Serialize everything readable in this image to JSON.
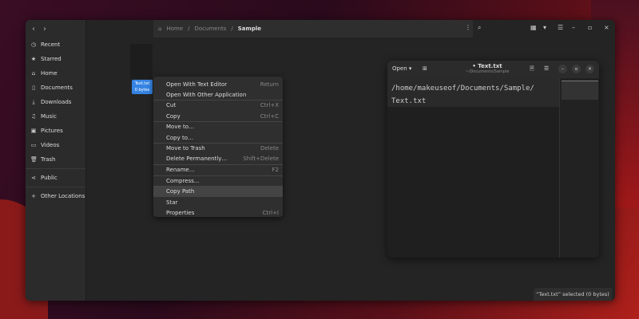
{
  "files": {
    "breadcrumb": [
      "Home",
      "Documents",
      "Sample"
    ],
    "sidebar": [
      {
        "icon": "clock",
        "label": "Recent"
      },
      {
        "icon": "star",
        "label": "Starred"
      },
      {
        "icon": "home",
        "label": "Home"
      },
      {
        "icon": "document",
        "label": "Documents"
      },
      {
        "icon": "download",
        "label": "Downloads"
      },
      {
        "icon": "music",
        "label": "Music"
      },
      {
        "icon": "picture",
        "label": "Pictures"
      },
      {
        "icon": "video",
        "label": "Videos"
      },
      {
        "icon": "trash",
        "label": "Trash"
      },
      {
        "icon": "share",
        "label": "Public"
      },
      {
        "icon": "plus",
        "label": "Other Locations"
      }
    ],
    "file": {
      "name": "Text.txt",
      "size": "0 bytes"
    },
    "status": "“Text.txt” selected (0 bytes)"
  },
  "menu": [
    {
      "label": "Open With Text Editor",
      "accel": "Return"
    },
    {
      "label": "Open With Other Application",
      "accel": ""
    },
    {
      "label": "Cut",
      "accel": "Ctrl+X"
    },
    {
      "label": "Copy",
      "accel": "Ctrl+C"
    },
    {
      "label": "Move to…",
      "accel": ""
    },
    {
      "label": "Copy to…",
      "accel": ""
    },
    {
      "label": "Move to Trash",
      "accel": "Delete"
    },
    {
      "label": "Delete Permanently…",
      "accel": "Shift+Delete"
    },
    {
      "label": "Rename…",
      "accel": "F2"
    },
    {
      "label": "Compress…",
      "accel": ""
    },
    {
      "label": "Copy Path",
      "accel": ""
    },
    {
      "label": "Star",
      "accel": ""
    },
    {
      "label": "Properties",
      "accel": "Ctrl+I"
    }
  ],
  "editor": {
    "open_label": "Open",
    "title": "• Text.txt",
    "subtitle": "~/Documents/Sample",
    "lines": [
      "/home/makeuseof/Documents/Sample/",
      "Text.txt"
    ]
  }
}
